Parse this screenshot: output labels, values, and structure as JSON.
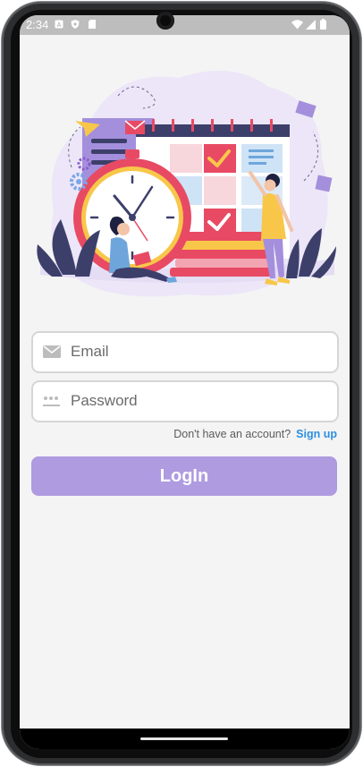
{
  "status_bar": {
    "time": "2:34",
    "left_icons": [
      "notification-a-icon",
      "shield-icon",
      "sd-card-icon"
    ],
    "right_icons": [
      "wifi-icon",
      "signal-icon",
      "battery-icon"
    ]
  },
  "hero": {
    "illustration": "time-management-illustration",
    "icons": [
      "clock-icon",
      "calendar-icon",
      "check-icon",
      "paper-plane-icon",
      "envelope-icon",
      "gear-icon"
    ]
  },
  "login_form": {
    "email": {
      "placeholder": "Email",
      "icon": "email-icon"
    },
    "password": {
      "placeholder": "Password",
      "icon": "password-dots-icon"
    },
    "signup_prompt": "Don't have an account?",
    "signup_link": "Sign up",
    "login_button": "LogIn"
  },
  "colors": {
    "accent": "#ae9be0",
    "link": "#2d8fe0",
    "background": "#f4f4f4"
  }
}
